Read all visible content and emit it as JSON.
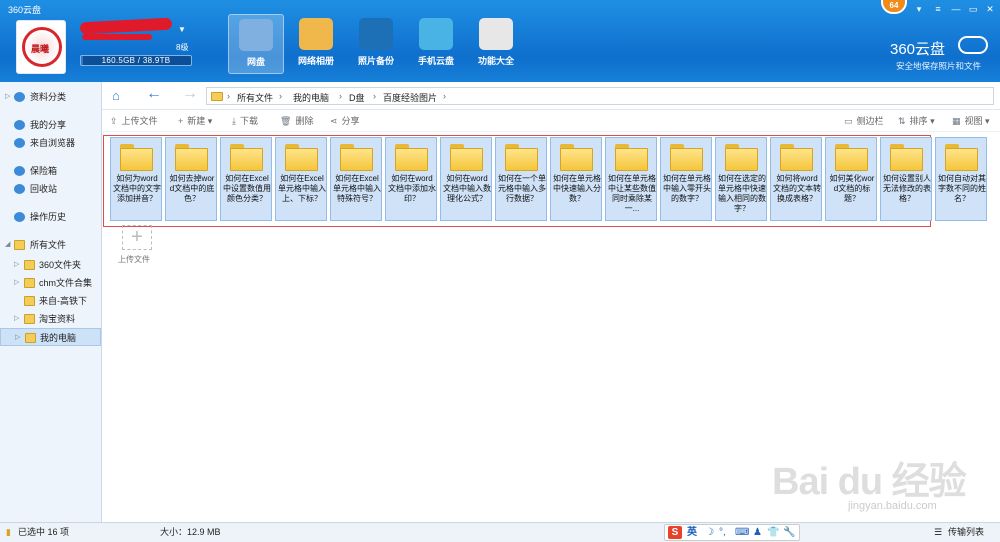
{
  "window": {
    "title": "360云盘",
    "notification_count": "64",
    "controls": [
      "▾",
      "—",
      "▭",
      "✕"
    ]
  },
  "user": {
    "level": "8级",
    "quota_text": "160.5GB / 38.9TB",
    "quota_fraction": 0.004
  },
  "nav": [
    {
      "label": "网盘",
      "icon": "cloud-drive-icon",
      "active": true
    },
    {
      "label": "网络相册",
      "icon": "photo-album-icon"
    },
    {
      "label": "照片备份",
      "icon": "camera-icon"
    },
    {
      "label": "手机云盘",
      "icon": "phone-cloud-icon"
    },
    {
      "label": "功能大全",
      "icon": "toolbox-icon"
    }
  ],
  "brand": {
    "name": "360云盘",
    "tagline": "安全地保存照片和文件"
  },
  "sidebar": [
    {
      "label": "资料分类",
      "icon": "category-icon",
      "arrow": "▷"
    },
    {
      "label": "我的分享",
      "icon": "share-icon"
    },
    {
      "label": "来自浏览器",
      "icon": "browser-icon"
    },
    {
      "label": "保险箱",
      "icon": "safe-icon"
    },
    {
      "label": "回收站",
      "icon": "recycle-bin-icon"
    },
    {
      "label": "操作历史",
      "icon": "history-icon"
    },
    {
      "label": "所有文件",
      "icon": "all-files-icon",
      "arrow": "◢"
    },
    {
      "label": "360文件夹",
      "icon": "folder-icon",
      "arrow": "▷"
    },
    {
      "label": "chm文件合集",
      "icon": "folder-icon",
      "arrow": "▷"
    },
    {
      "label": "来自-高铁下",
      "icon": "folder-icon"
    },
    {
      "label": "淘宝资料",
      "icon": "folder-icon",
      "arrow": "▷"
    },
    {
      "label": "我的电脑",
      "icon": "folder-icon",
      "arrow": "▷",
      "selected": true
    }
  ],
  "breadcrumb": [
    "所有文件",
    "我的电脑",
    "D盘",
    "百度经验图片"
  ],
  "actions": [
    {
      "label": "上传文件",
      "icon": "upload-icon"
    },
    {
      "label": "新建",
      "icon": "plus-icon"
    },
    {
      "label": "下载",
      "icon": "download-icon"
    },
    {
      "label": "删除",
      "icon": "delete-icon"
    },
    {
      "label": "分享",
      "icon": "share-icon"
    }
  ],
  "view_actions": [
    {
      "label": "侧边栏",
      "icon": "sidebar-icon"
    },
    {
      "label": "排序",
      "icon": "sort-icon"
    },
    {
      "label": "视图",
      "icon": "grid-view-icon"
    }
  ],
  "files": [
    "如何为word文档中的文字添加拼音？",
    "如何去掉word文档中的底色？",
    "如何在Excel中设置数值用颜色分类？",
    "如何在Excel单元格中输入上、下标？",
    "如何在Excel单元格中输入特殊符号？",
    "如何在word文档中添加水印？",
    "如何在word文档中输入数理化公式？",
    "如何在一个单元格中输入多行数据？",
    "如何在单元格中快速输入分数？",
    "如何在单元格中让某些数值同时乘除某一...",
    "如何在单元格中输入零开头的数字？",
    "如何在选定的单元格中快速输入相同的数字？",
    "如何将word文档的文本转换成表格？",
    "如何美化word文档的标题？",
    "如何设置别人无法修改的表格？",
    "如何自动对其字数不同的姓名？"
  ],
  "upload_tile": {
    "label": "上传文件"
  },
  "status": {
    "selected": "已选中 16 项",
    "size": "大小：12.9 MB",
    "transfer": "传输列表"
  },
  "ime": {
    "label": "英"
  },
  "watermark": {
    "text": "Bai du 经验",
    "url": "jingyan.baidu.com"
  },
  "colors": {
    "header": "#1577d6",
    "selection_border": "#e34b4b",
    "tile_bg": "#cfe2f8"
  }
}
